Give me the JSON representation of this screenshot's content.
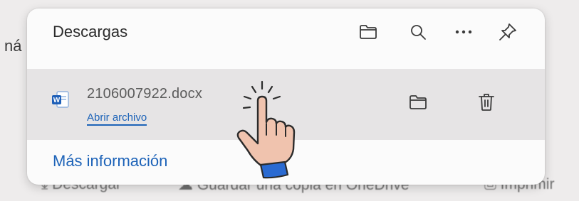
{
  "background": {
    "left_text": "ná",
    "bottom_items": [
      "Descargar",
      "Guardar una copia en OneDrive",
      "Imprimir"
    ]
  },
  "flyout": {
    "title": "Descargas",
    "header_icons": [
      "folder-icon",
      "search-icon",
      "more-icon",
      "pin-icon"
    ]
  },
  "download": {
    "file_name": "2106007922.docx",
    "open_label": "Abrir archivo",
    "file_type_icon": "word-doc-icon",
    "actions": [
      "show-in-folder-icon",
      "delete-icon"
    ]
  },
  "footer": {
    "more_info": "Más información"
  },
  "colors": {
    "accent": "#1d63b8",
    "row_bg": "#e6e4e5",
    "panel_bg": "#fbfbfb"
  }
}
